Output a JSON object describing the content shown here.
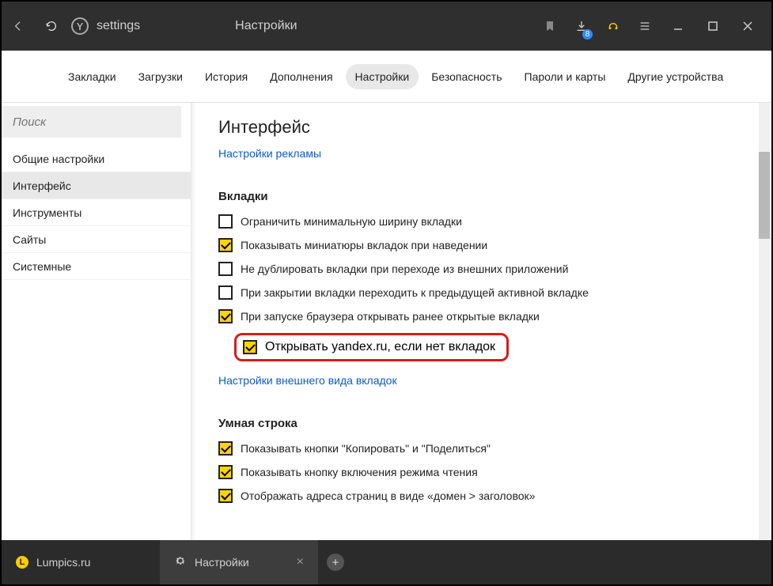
{
  "titlebar": {
    "address": "settings",
    "page_title": "Настройки",
    "download_count": "8"
  },
  "navbar": {
    "items": [
      {
        "label": "Закладки"
      },
      {
        "label": "Загрузки"
      },
      {
        "label": "История"
      },
      {
        "label": "Дополнения"
      },
      {
        "label": "Настройки",
        "active": true
      },
      {
        "label": "Безопасность"
      },
      {
        "label": "Пароли и карты"
      },
      {
        "label": "Другие устройства"
      }
    ]
  },
  "sidebar": {
    "search_placeholder": "Поиск",
    "items": [
      {
        "label": "Общие настройки"
      },
      {
        "label": "Интерфейс",
        "active": true
      },
      {
        "label": "Инструменты"
      },
      {
        "label": "Сайты"
      },
      {
        "label": "Системные"
      }
    ]
  },
  "main": {
    "heading": "Интерфейс",
    "ad_settings_link": "Настройки рекламы",
    "section_tabs": {
      "title": "Вкладки",
      "options": [
        {
          "label": "Ограничить минимальную ширину вкладки",
          "checked": false
        },
        {
          "label": "Показывать миниатюры вкладок при наведении",
          "checked": true
        },
        {
          "label": "Не дублировать вкладки при переходе из внешних приложений",
          "checked": false
        },
        {
          "label": "При закрытии вкладки переходить к предыдущей активной вкладке",
          "checked": false
        },
        {
          "label": "При запуске браузера открывать ранее открытые вкладки",
          "checked": true
        }
      ],
      "highlighted_option": {
        "label": "Открывать yandex.ru, если нет вкладок",
        "checked": true
      },
      "appearance_link": "Настройки внешнего вида вкладок"
    },
    "section_smartbar": {
      "title": "Умная строка",
      "options": [
        {
          "label": "Показывать кнопки \"Копировать\" и \"Поделиться\"",
          "checked": true
        },
        {
          "label": "Показывать кнопку включения режима чтения",
          "checked": true
        },
        {
          "label": "Отображать адреса страниц в виде «домен > заголовок»",
          "checked": true
        }
      ]
    }
  },
  "tabbar": {
    "tabs": [
      {
        "label": "Lumpics.ru",
        "favicon": "L"
      },
      {
        "label": "Настройки",
        "gear": true,
        "active": true,
        "closable": true
      }
    ]
  }
}
